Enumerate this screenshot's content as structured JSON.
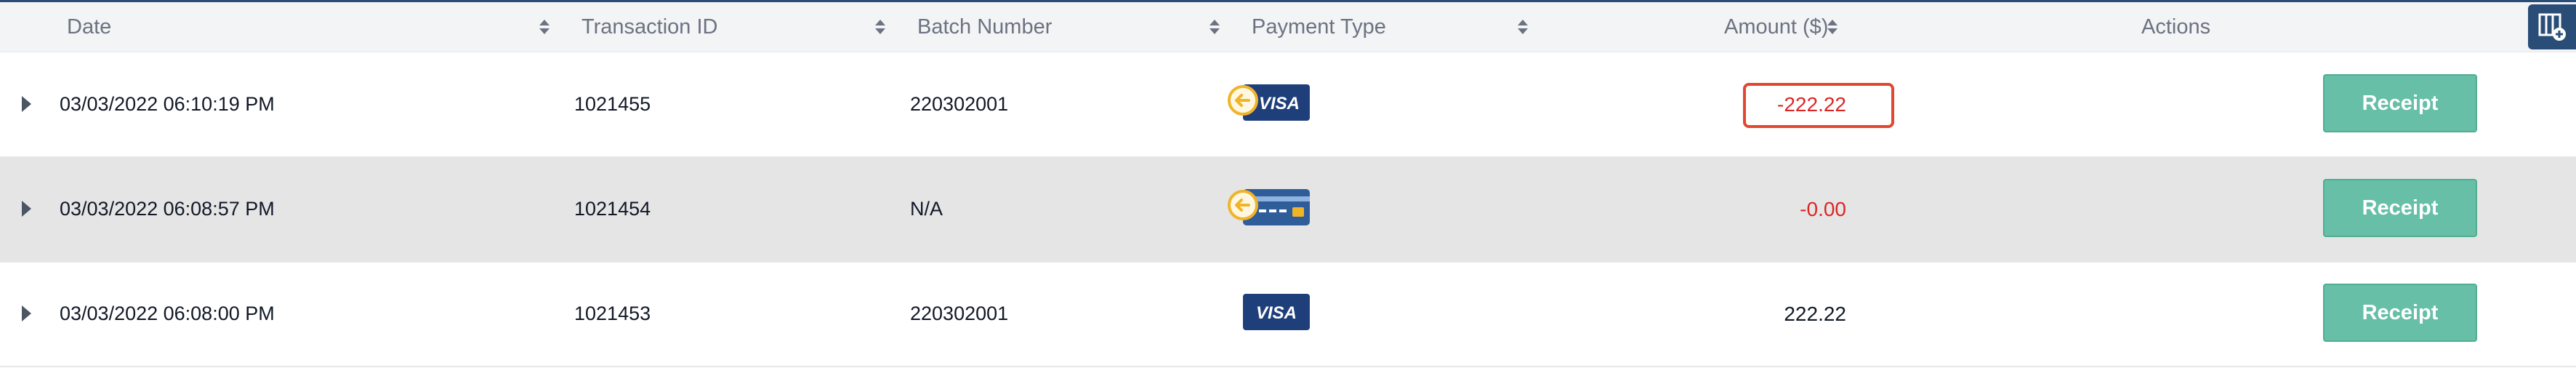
{
  "table": {
    "columns": {
      "date": "Date",
      "transaction_id": "Transaction ID",
      "batch_number": "Batch Number",
      "payment_type": "Payment Type",
      "amount": "Amount ($)",
      "actions": "Actions"
    },
    "column_settings_icon": "column-settings-icon",
    "rows": [
      {
        "date": "03/03/2022 06:10:19 PM",
        "transaction_id": "1021455",
        "batch_number": "220302001",
        "payment_type": "visa-refund",
        "card_text": "VISA",
        "amount": "-222.22",
        "amount_status": "negative-highlighted",
        "action_label": "Receipt"
      },
      {
        "date": "03/03/2022 06:08:57 PM",
        "transaction_id": "1021454",
        "batch_number": "N/A",
        "payment_type": "card-refund",
        "card_text": "",
        "amount": "-0.00",
        "amount_status": "negative",
        "action_label": "Receipt"
      },
      {
        "date": "03/03/2022 06:08:00 PM",
        "transaction_id": "1021453",
        "batch_number": "220302001",
        "payment_type": "visa",
        "card_text": "VISA",
        "amount": "222.22",
        "amount_status": "positive",
        "action_label": "Receipt"
      }
    ]
  },
  "colors": {
    "accent": "#2a4d78",
    "receipt_button": "#66bfa6",
    "negative_amount": "#dc2626",
    "highlight_border": "#e0482f",
    "alt_row": "#e5e5e5"
  }
}
